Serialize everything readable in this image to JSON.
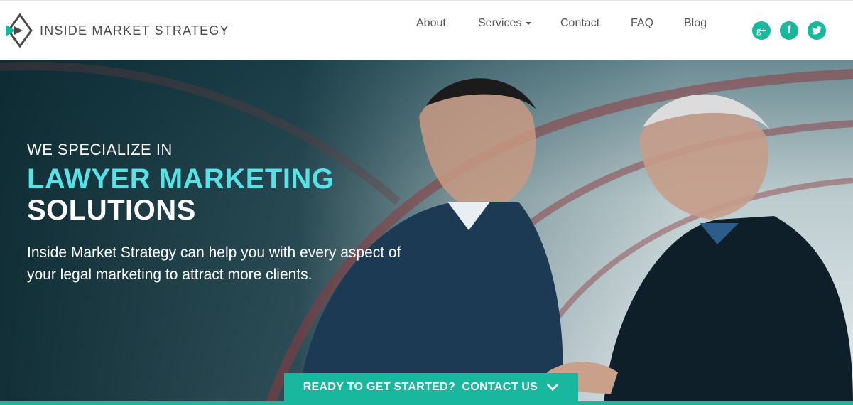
{
  "brand": {
    "name": "INSIDE MARKET STRATEGY"
  },
  "nav": {
    "items": [
      {
        "label": "About"
      },
      {
        "label": "Services"
      },
      {
        "label": "Contact"
      },
      {
        "label": "FAQ"
      },
      {
        "label": "Blog"
      }
    ]
  },
  "social": [
    {
      "name": "google-plus-icon",
      "glyph": "g+"
    },
    {
      "name": "facebook-icon",
      "glyph": "f"
    },
    {
      "name": "twitter-icon",
      "glyph": ""
    }
  ],
  "hero": {
    "kicker": "WE SPECIALIZE IN",
    "highlight": "LAWYER MARKETING",
    "title": "SOLUTIONS",
    "description": "Inside Market Strategy can help you with every aspect of your legal marketing to attract more clients."
  },
  "cta": {
    "label": "READY TO GET STARTED?  CONTACT US"
  },
  "colors": {
    "accent": "#19b89e",
    "highlight": "#56e3e8",
    "logo_dark": "#4b4b4b"
  }
}
